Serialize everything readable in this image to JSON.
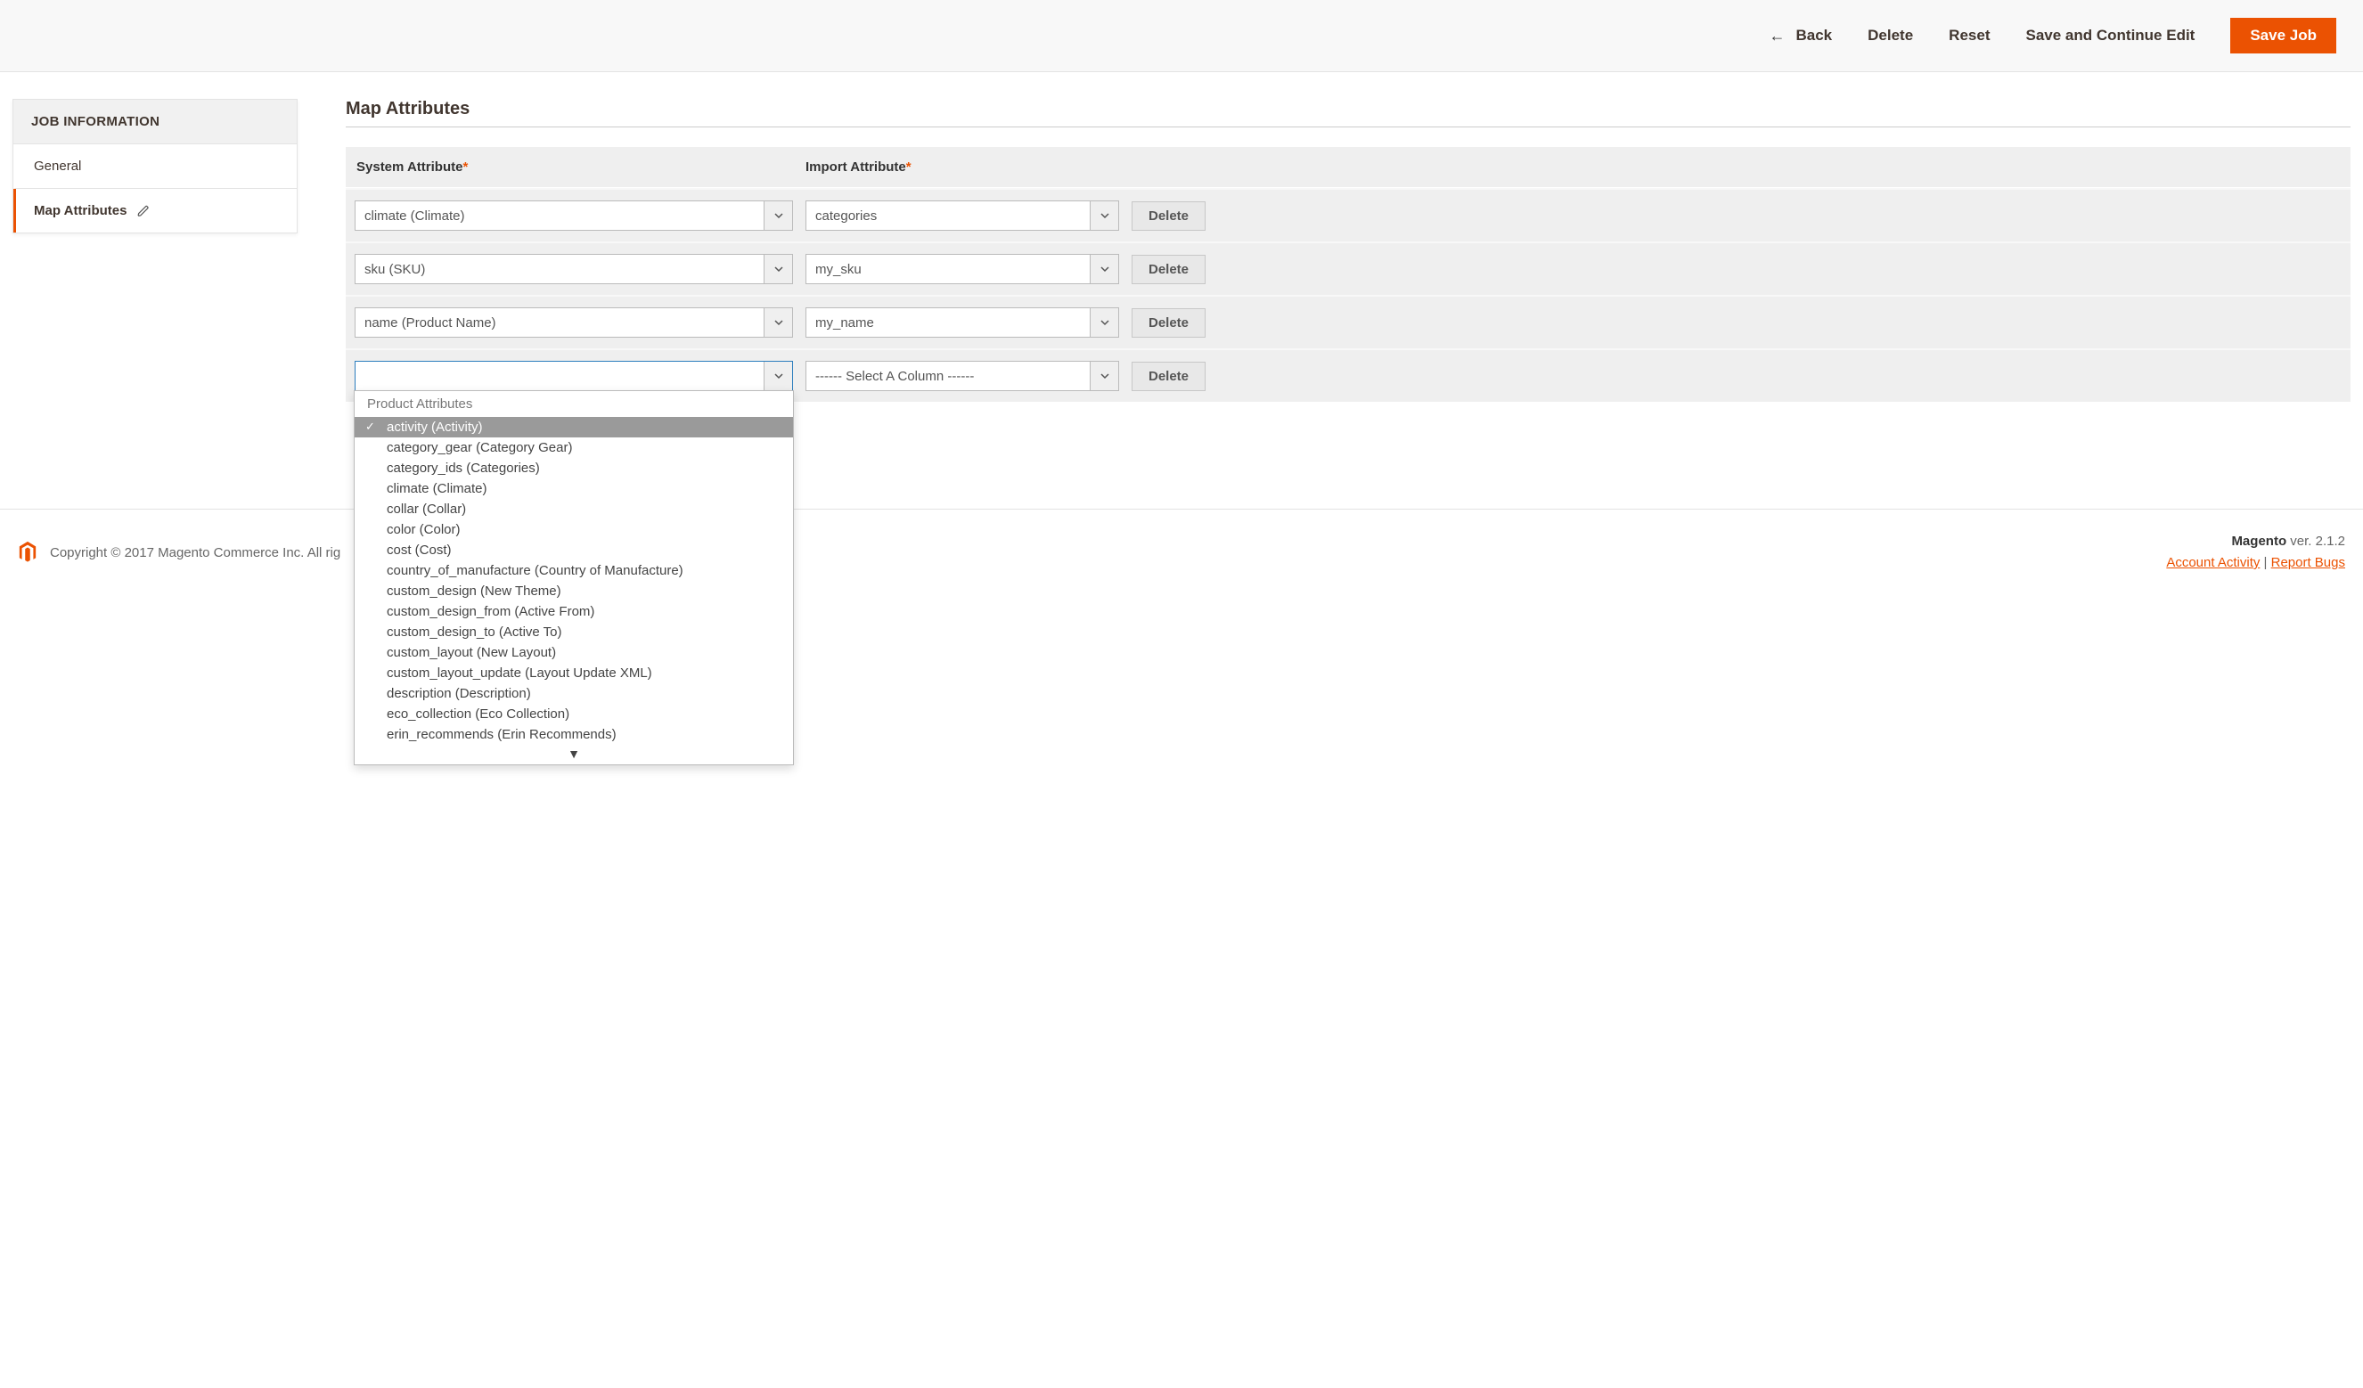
{
  "toolbar": {
    "back": "Back",
    "delete": "Delete",
    "reset": "Reset",
    "save_continue": "Save and Continue Edit",
    "save_job": "Save Job"
  },
  "sidebar": {
    "header": "JOB INFORMATION",
    "items": [
      {
        "label": "General",
        "active": false
      },
      {
        "label": "Map Attributes",
        "active": true
      }
    ]
  },
  "section_title": "Map Attributes",
  "columns": {
    "system": "System Attribute",
    "import": "Import Attribute"
  },
  "rows": [
    {
      "system": "climate (Climate)",
      "import": "categories",
      "delete": "Delete"
    },
    {
      "system": "sku (SKU)",
      "import": "my_sku",
      "delete": "Delete"
    },
    {
      "system": "name (Product Name)",
      "import": "my_name",
      "delete": "Delete"
    },
    {
      "system": "",
      "import": "------ Select A Column ------",
      "delete": "Delete"
    }
  ],
  "dropdown": {
    "group": "Product Attributes",
    "selected_index": 0,
    "items": [
      "activity (Activity)",
      "category_gear (Category Gear)",
      "category_ids (Categories)",
      "climate (Climate)",
      "collar (Collar)",
      "color (Color)",
      "cost (Cost)",
      "country_of_manufacture (Country of Manufacture)",
      "custom_design (New Theme)",
      "custom_design_from (Active From)",
      "custom_design_to (Active To)",
      "custom_layout (New Layout)",
      "custom_layout_update (Layout Update XML)",
      "description (Description)",
      "eco_collection (Eco Collection)",
      "erin_recommends (Erin Recommends)"
    ]
  },
  "footer": {
    "copyright": "Copyright © 2017 Magento Commerce Inc. All rig",
    "brand": "Magento",
    "version_prefix": " ver. ",
    "version": "2.1.2",
    "account": "Account Activity",
    "bugs": "Report Bugs",
    "sep": " | "
  }
}
